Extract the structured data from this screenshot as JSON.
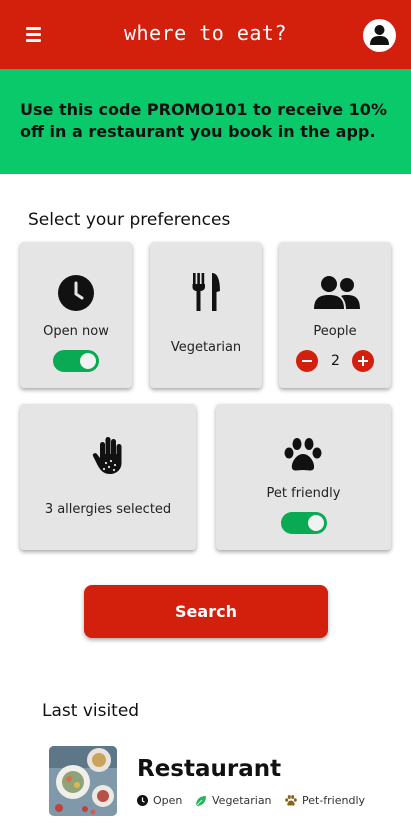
{
  "header": {
    "title": "where to eat?",
    "menu_icon": "hamburger-menu-icon",
    "profile_icon": "user-avatar-icon",
    "background": "#d2200d"
  },
  "promo": {
    "text": "Use this code PROMO101 to receive 10% off in a restaurant you book in the app.",
    "background": "#09c96a"
  },
  "preferences": {
    "title": "Select your preferences",
    "open_now": {
      "label": "Open now",
      "icon": "clock-icon",
      "enabled": true
    },
    "vegetarian": {
      "label": "Vegetarian",
      "icon": "fork-knife-icon"
    },
    "people": {
      "label": "People",
      "icon": "people-icon",
      "count": "2",
      "decrement_icon": "minus-icon",
      "increment_icon": "plus-icon"
    },
    "allergies": {
      "label": "3 allergies selected",
      "icon": "hand-icon"
    },
    "pet_friendly": {
      "label": "Pet friendly",
      "icon": "paw-icon",
      "enabled": true
    }
  },
  "search": {
    "label": "Search",
    "color": "#d2200d"
  },
  "last_visited": {
    "title": "Last visited",
    "items": [
      {
        "name": "Restaurant",
        "tags": [
          {
            "label": "Open",
            "icon": "clock-icon"
          },
          {
            "label": "Vegetarian",
            "icon": "leaf-icon"
          },
          {
            "label": "Pet-friendly",
            "icon": "paw-icon"
          }
        ]
      }
    ]
  },
  "colors": {
    "accent": "#d2200d",
    "toggle_on": "#0aaa55",
    "card_bg": "#e5e5e5"
  }
}
